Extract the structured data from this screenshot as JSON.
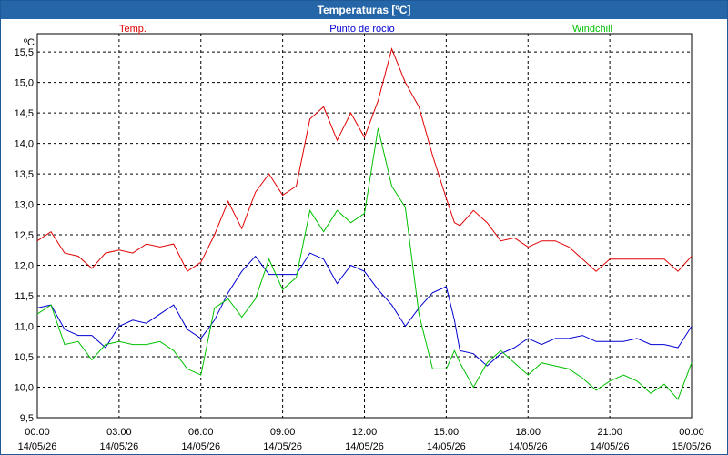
{
  "window": {
    "title": "Temperaturas [ºC]"
  },
  "chart_data": {
    "type": "line",
    "title": "Temperaturas [ºC]",
    "ylabel": "ºC",
    "ylim": [
      9.5,
      15.8
    ],
    "yticks": [
      "9,5",
      "10,0",
      "10,5",
      "11,0",
      "11,5",
      "12,0",
      "12,5",
      "13,0",
      "13,5",
      "14,0",
      "14,5",
      "15,0",
      "15,5"
    ],
    "xlim": [
      0,
      24
    ],
    "xticks": [
      {
        "time": "00:00",
        "date": "14/05/26"
      },
      {
        "time": "03:00",
        "date": "14/05/26"
      },
      {
        "time": "06:00",
        "date": "14/05/26"
      },
      {
        "time": "09:00",
        "date": "14/05/26"
      },
      {
        "time": "12:00",
        "date": "14/05/26"
      },
      {
        "time": "15:00",
        "date": "14/05/26"
      },
      {
        "time": "18:00",
        "date": "14/05/26"
      },
      {
        "time": "21:00",
        "date": "14/05/26"
      },
      {
        "time": "00:00",
        "date": "15/05/26"
      }
    ],
    "grid": true,
    "legend_position": "top",
    "series": [
      {
        "name": "Temp.",
        "color": "#e00000",
        "x": [
          0,
          0.5,
          1,
          1.5,
          2,
          2.5,
          3,
          3.5,
          4,
          4.5,
          5,
          5.5,
          6,
          6.5,
          7,
          7.5,
          8,
          8.5,
          9,
          9.5,
          10,
          10.5,
          11,
          11.5,
          12,
          12.5,
          13,
          13.5,
          14,
          14.5,
          15,
          15.3,
          15.5,
          16,
          16.5,
          17,
          17.5,
          18,
          18.5,
          19,
          19.5,
          20,
          20.5,
          21,
          21.5,
          22,
          22.5,
          23,
          23.5,
          24
        ],
        "values": [
          12.4,
          12.55,
          12.2,
          12.15,
          11.95,
          12.2,
          12.25,
          12.2,
          12.35,
          12.3,
          12.35,
          11.9,
          12.05,
          12.5,
          13.05,
          12.6,
          13.2,
          13.5,
          13.15,
          13.3,
          14.4,
          14.6,
          14.05,
          14.5,
          14.1,
          14.7,
          15.55,
          15.0,
          14.6,
          13.8,
          13.1,
          12.7,
          12.65,
          12.9,
          12.7,
          12.4,
          12.45,
          12.3,
          12.4,
          12.4,
          12.3,
          12.1,
          11.9,
          12.1,
          12.1,
          12.1,
          12.1,
          12.1,
          11.9,
          12.15
        ]
      },
      {
        "name": "Punto de rocío",
        "color": "#0000d0",
        "x": [
          0,
          0.5,
          1,
          1.5,
          2,
          2.5,
          3,
          3.5,
          4,
          4.5,
          5,
          5.5,
          6,
          6.5,
          7,
          7.5,
          8,
          8.5,
          9,
          9.5,
          10,
          10.5,
          11,
          11.5,
          12,
          12.5,
          13,
          13.5,
          14,
          14.5,
          15,
          15.3,
          15.5,
          16,
          16.5,
          17,
          17.5,
          18,
          18.5,
          19,
          19.5,
          20,
          20.5,
          21,
          21.5,
          22,
          22.5,
          23,
          23.5,
          24
        ],
        "values": [
          11.3,
          11.35,
          10.95,
          10.85,
          10.85,
          10.65,
          11.0,
          11.1,
          11.05,
          11.2,
          11.35,
          10.95,
          10.8,
          11.1,
          11.55,
          11.9,
          12.15,
          11.85,
          11.85,
          11.85,
          12.2,
          12.1,
          11.7,
          12.0,
          11.9,
          11.6,
          11.35,
          11.0,
          11.3,
          11.55,
          11.65,
          11.1,
          10.6,
          10.55,
          10.35,
          10.55,
          10.65,
          10.8,
          10.7,
          10.8,
          10.8,
          10.85,
          10.75,
          10.75,
          10.75,
          10.8,
          10.7,
          10.7,
          10.65,
          11.0
        ]
      },
      {
        "name": "Windchill",
        "color": "#00c000",
        "x": [
          0,
          0.5,
          1,
          1.5,
          2,
          2.5,
          3,
          3.5,
          4,
          4.5,
          5,
          5.5,
          6,
          6.5,
          7,
          7.5,
          8,
          8.5,
          9,
          9.5,
          10,
          10.5,
          11,
          11.5,
          12,
          12.5,
          13,
          13.5,
          14,
          14.5,
          15,
          15.3,
          15.5,
          16,
          16.5,
          17,
          17.5,
          18,
          18.5,
          19,
          19.5,
          20,
          20.5,
          21,
          21.5,
          22,
          22.5,
          23,
          23.5,
          24
        ],
        "values": [
          11.2,
          11.35,
          10.7,
          10.75,
          10.45,
          10.7,
          10.75,
          10.7,
          10.7,
          10.75,
          10.6,
          10.3,
          10.2,
          11.3,
          11.45,
          11.15,
          11.45,
          12.1,
          11.6,
          11.8,
          12.9,
          12.55,
          12.9,
          12.7,
          12.85,
          14.25,
          13.3,
          12.95,
          11.2,
          10.3,
          10.3,
          10.6,
          10.4,
          10.0,
          10.4,
          10.6,
          10.4,
          10.2,
          10.4,
          10.35,
          10.3,
          10.15,
          9.95,
          10.1,
          10.2,
          10.1,
          9.9,
          10.05,
          9.8,
          10.4
        ]
      }
    ]
  }
}
